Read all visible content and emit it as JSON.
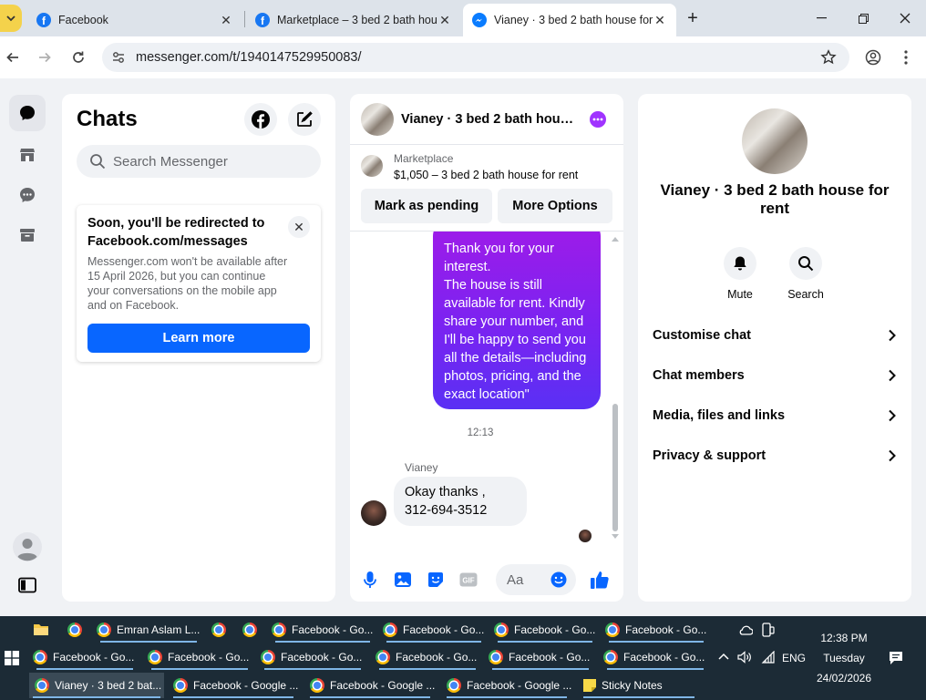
{
  "browser": {
    "tabs": [
      {
        "title": "Facebook",
        "icon": "facebook-icon"
      },
      {
        "title": "Marketplace – 3 bed 2 bath hou",
        "icon": "facebook-icon"
      },
      {
        "title": "Vianey · 3 bed 2 bath house for",
        "icon": "messenger-icon",
        "active": true
      }
    ],
    "url": "messenger.com/t/1940147529950083/"
  },
  "chats": {
    "title": "Chats",
    "search_placeholder": "Search Messenger",
    "notice": {
      "title": "Soon, you'll be redirected to Facebook.com/messages",
      "body": "Messenger.com won't be available after 15 April 2026, but you can continue your conversations on the mobile app and on Facebook.",
      "button": "Learn more"
    }
  },
  "conversation": {
    "title": "Vianey · 3 bed 2 bath hou…",
    "marketplace_label": "Marketplace",
    "listing": "$1,050 – 3 bed 2 bath house for rent",
    "mark_pending": "Mark as pending",
    "more_options": "More Options",
    "outgoing_message": "Thank you for your\ninterest.\nThe house is still available for rent. Kindly share your number, and I'll be happy to send you all the details—including photos, pricing, and the exact location\"",
    "timestamp": "12:13",
    "sender": "Vianey",
    "incoming_message": "Okay thanks ,\n312-694-3512",
    "composer_placeholder": "Aa"
  },
  "info": {
    "name": "Vianey · 3 bed 2 bath house for rent",
    "actions": [
      {
        "label": "Mute",
        "icon": "bell-icon"
      },
      {
        "label": "Search",
        "icon": "search-icon"
      }
    ],
    "rows": [
      "Customise chat",
      "Chat members",
      "Media, files and links",
      "Privacy & support"
    ]
  },
  "taskbar": {
    "row1": [
      {
        "label": "",
        "icon": "file-explorer-icon"
      },
      {
        "label": "",
        "icon": "chrome-icon"
      },
      {
        "label": "Emran Aslam L...",
        "icon": "chrome-icon"
      },
      {
        "label": "",
        "icon": "chrome-icon"
      },
      {
        "label": "",
        "icon": "chrome-icon"
      },
      {
        "label": "Facebook - Go...",
        "icon": "chrome-icon"
      },
      {
        "label": "Facebook - Go...",
        "icon": "chrome-icon"
      },
      {
        "label": "Facebook - Go...",
        "icon": "chrome-icon"
      },
      {
        "label": "Facebook - Go...",
        "icon": "chrome-icon"
      }
    ],
    "row2": [
      "Facebook - Go...",
      "Facebook - Go...",
      "Facebook - Go...",
      "Facebook - Go...",
      "Facebook - Go...",
      "Facebook - Go..."
    ],
    "row3": [
      {
        "label": "Vianey · 3 bed 2 bat...",
        "icon": "chrome-icon",
        "active": true
      },
      {
        "label": "Facebook - Google ...",
        "icon": "chrome-icon"
      },
      {
        "label": "Facebook - Google ...",
        "icon": "chrome-icon"
      },
      {
        "label": "Facebook - Google ...",
        "icon": "chrome-icon"
      },
      {
        "label": "Sticky Notes",
        "icon": "sticky-notes-icon"
      }
    ],
    "language": "ENG",
    "time": "12:38 PM",
    "day": "Tuesday",
    "date": "24/02/2026"
  },
  "colors": {
    "accent": "#0866ff",
    "bubble_top": "#a01be8",
    "bubble_bottom": "#5a30f4",
    "taskbar": "#1c2b36"
  }
}
